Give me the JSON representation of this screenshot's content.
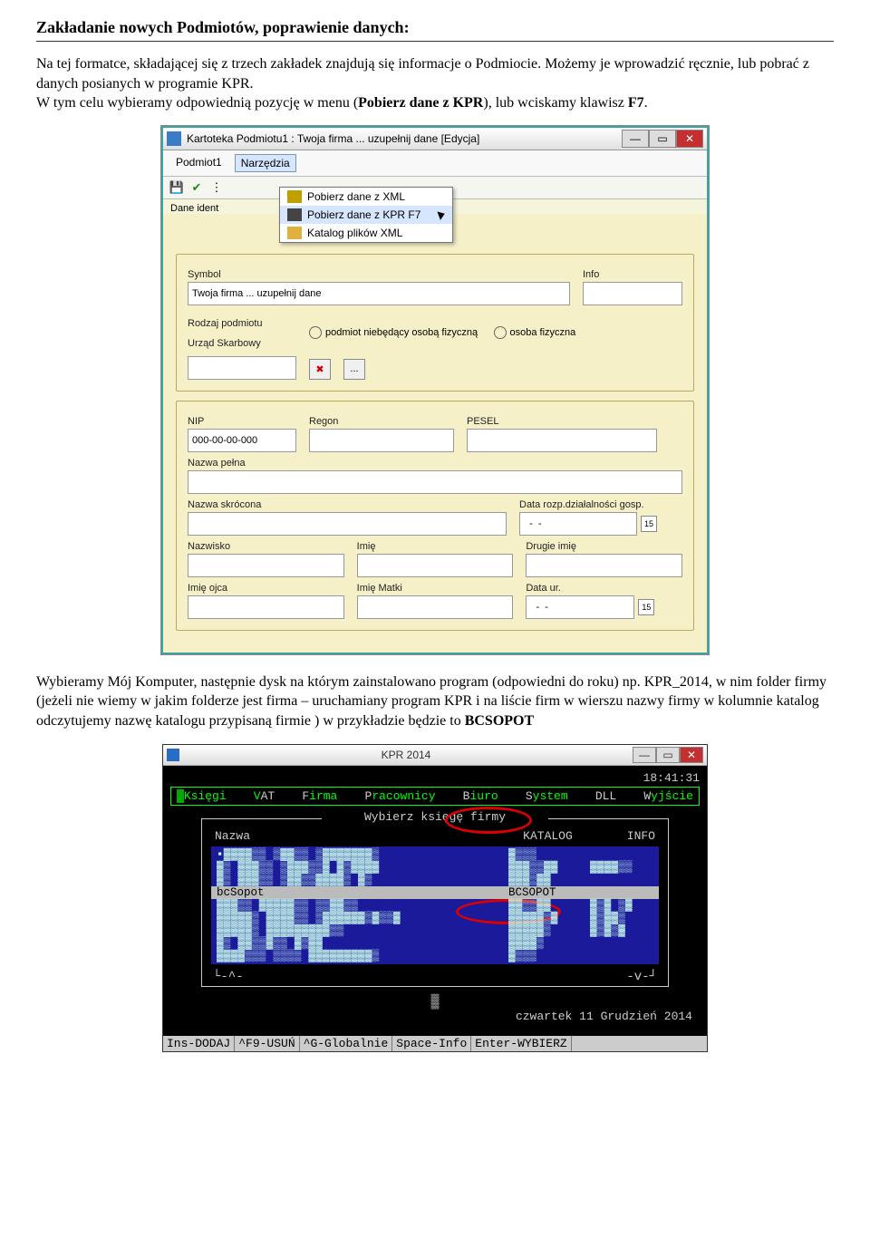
{
  "doc": {
    "heading": "Zakładanie nowych Podmiotów, poprawienie danych:",
    "para1_a": "Na tej formatce, składającej się z trzech zakładek znajdują się informacje o Podmiocie. Możemy je wprowadzić ręcznie, lub pobrać z danych posianych w programie KPR.",
    "para1_b": "W tym celu wybieramy odpowiednią pozycję w menu (",
    "para1_bold": "Pobierz dane z KPR",
    "para1_c": "), lub wciskamy klawisz ",
    "para1_bold2": "F7",
    "para1_d": ".",
    "para2_a": "Wybieramy Mój Komputer, następnie dysk na którym zainstalowano program (odpowiedni do roku) np. KPR_2014, w nim folder firmy  (jeżeli nie wiemy w jakim folderze jest firma – uruchamiany program KPR i na liście firm w wierszu nazwy firmy w kolumnie katalog odczytujemy nazwę katalogu przypisaną firmie ) w przykładzie będzie to ",
    "para2_bold": "BCSOPOT"
  },
  "app": {
    "title": "Kartoteka Podmiotu1 : Twoja firma ... uzupełnij dane [Edycja]",
    "menu": {
      "podmiot": "Podmiot1",
      "narzedzia": "Narzędzia"
    },
    "dropdown": {
      "xml": "Pobierz dane z XML",
      "kpr": "Pobierz dane z KPR F7",
      "katalog": "Katalog plików XML"
    },
    "form": {
      "symbol_lbl": "Symbol",
      "symbol_val": "Twoja firma ... uzupełnij dane",
      "info_lbl": "Info",
      "rodzaj_lbl": "Rodzaj podmiotu",
      "radio1": "podmiot niebędący osobą fizyczną",
      "radio2": "osoba fizyczna",
      "urzad_lbl": "Urząd Skarbowy",
      "urzad_btn": "...",
      "nip_lbl": "NIP",
      "nip_val": "000-00-00-000",
      "regon_lbl": "Regon",
      "pesel_lbl": "PESEL",
      "nazwa_pelna_lbl": "Nazwa pełna",
      "nazwa_skr_lbl": "Nazwa skrócona",
      "data_rozp_lbl": "Data rozp.działalności gosp.",
      "data_rozp_val": "  -  -",
      "nazwisko_lbl": "Nazwisko",
      "imie_lbl": "Imię",
      "drugie_lbl": "Drugie imię",
      "imie_ojca_lbl": "Imię ojca",
      "imie_matki_lbl": "Imię Matki",
      "data_ur_lbl": "Data ur.",
      "data_ur_val": "  -  -",
      "cal_icon": "15"
    },
    "dane_left": "Dane ident"
  },
  "console": {
    "title": "KPR 2014",
    "clock": "18:41:31",
    "menu": {
      "ksiegi": "Księgi",
      "vat": "VAT",
      "firma": "Firma",
      "prac": "Pracownicy",
      "biuro": "Biuro",
      "system": "System",
      "dll": "DLL",
      "wyjscie": "Wyjście"
    },
    "box": {
      "title": "Wybierz księgę firmy",
      "h_nazwa": "Nazwa",
      "h_katalog": "KATALOG",
      "h_info": "INFO",
      "rows": [
        {
          "c1": "▪▓▓▓▓▒▒ ▒▓▓▒▒ ▒▓▓▓▓▓▓▓▒",
          "c2": "▓▒▒▒",
          "c3": ""
        },
        {
          "c1": "▓▒ ▓▓▓▒▒ ▒▓▓▓▒▒▓ ▓▒▓▓▓▓",
          "c2": "▓▓▓▒▒▓▓",
          "c3": "▓▓▓▓▒▒"
        },
        {
          "c1": "▓▒ ▓▓▓▒▒ ▒▓▓▒▒▓▓▓▓▒ ▓▒",
          "c2": "▓▓▓▒▓▓",
          "c3": ""
        },
        {
          "c1": "bcSopot",
          "c2": "BCSOPOT",
          "c3": "",
          "sel": true
        },
        {
          "c1": "▓▓▓▒▒ ▓▓▓▓▓▒▒ ▒▒▓▓▒▒",
          "c2": "▓▓▒▒▓▓",
          "c3": "▓▒▓ ▒▓"
        },
        {
          "c1": "▓▓▓▓▓▒ ▓▓▓▓▒▒ ▒▓▓▓▓▓▓▒▓▒▒▓",
          "c2": "▓▓▓▓▓▒▓",
          "c3": "▓▒▓▓▒"
        },
        {
          "c1": "▓▓▓▓▓▒ ▓▓▓▓▓▓▓▓▓▒▒",
          "c2": "▓▓▓▓▓▒",
          "c3": "▓▒▓▒▓"
        },
        {
          "c1": "▓▒ ▓▓▒▒▓▒▒ ▓▒▓▓",
          "c2": "▓▓▓▓▒",
          "c3": ""
        },
        {
          "c1": "▓▓▓▓▒▒▒ ▒▒▒▒ ▓▓▓▓▓▓▓▓▓▒",
          "c2": "▓▒▒▒",
          "c3": ""
        }
      ],
      "arrow_up": "-^-",
      "arrow_dn": "-v-"
    },
    "wait": "▓",
    "date": "czwartek  11 Grudzień  2014",
    "bottom": {
      "ins": "Ins-DODAJ",
      "f9": "^F9-USUŃ",
      "g": "^G-Globalnie",
      "space": "Space-Info",
      "enter": "Enter-WYBIERZ"
    }
  }
}
